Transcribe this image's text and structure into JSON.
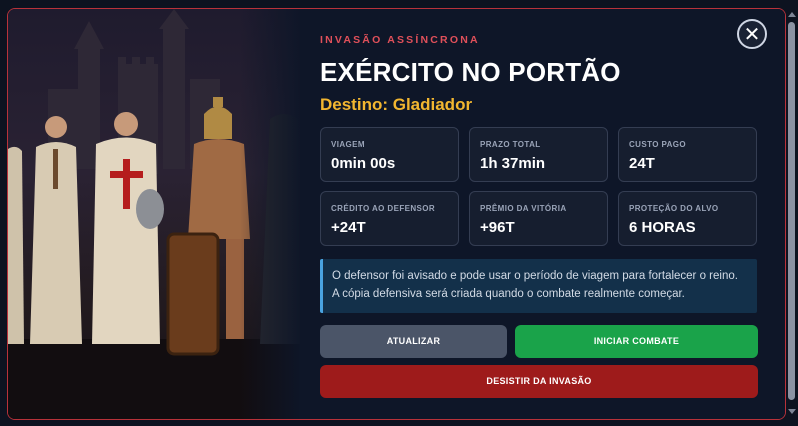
{
  "modal": {
    "eyebrow": "INVASÃO ASSÍNCRONA",
    "title": "EXÉRCITO NO PORTÃO",
    "destination": "Destino: Gladiador",
    "close_icon": "close-icon",
    "illustration": "knights-and-gladiator"
  },
  "stats": [
    {
      "label": "VIAGEM",
      "value": "0min 00s"
    },
    {
      "label": "PRAZO TOTAL",
      "value": "1h 37min"
    },
    {
      "label": "CUSTO PAGO",
      "value": "24T"
    },
    {
      "label": "CRÉDITO AO DEFENSOR",
      "value": "+24T"
    },
    {
      "label": "PRÊMIO DA VITÓRIA",
      "value": "+96T"
    },
    {
      "label": "PROTEÇÃO DO ALVO",
      "value": "6 HORAS"
    }
  ],
  "notice": "O defensor foi avisado e pode usar o período de viagem para fortalecer o reino. A cópia defensiva será criada quando o combate realmente começar.",
  "buttons": {
    "refresh": "ATUALIZAR",
    "start": "INICIAR COMBATE",
    "give_up": "DESISTIR DA INVASÃO"
  },
  "colors": {
    "accent_red": "#e0505a",
    "destination_gold": "#f2b630",
    "start_green": "#1aa34a",
    "giveup_red": "#9e1b1b",
    "refresh_gray": "#4b5568",
    "notice_blue": "#4aa3e0"
  }
}
